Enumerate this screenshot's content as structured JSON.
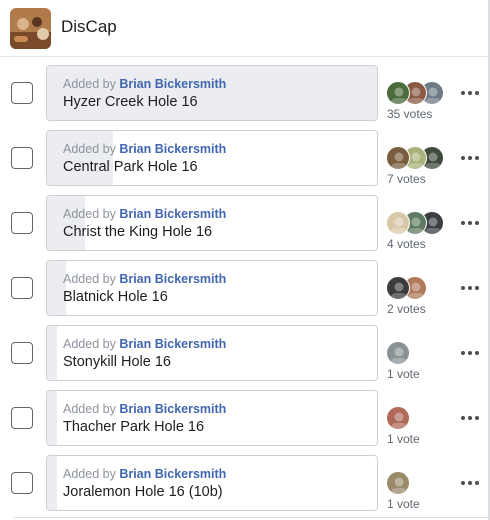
{
  "group": {
    "name": "DisCap",
    "thumbnail_icon": "group-photo"
  },
  "colors": {
    "author_link": "#4267b2",
    "vote_fill": "#ebedf0",
    "muted_text": "#8d949e"
  },
  "poll": {
    "added_prefix": "Added by",
    "options": [
      {
        "title": "Hyzer Creek Hole 16",
        "author": "Brian Bickersmith",
        "votes_label": "35 votes",
        "vote_share": 1.0,
        "voter_avatars": 3
      },
      {
        "title": "Central Park Hole 16",
        "author": "Brian Bickersmith",
        "votes_label": "7 votes",
        "vote_share": 0.2,
        "voter_avatars": 3
      },
      {
        "title": "Christ the King Hole 16",
        "author": "Brian Bickersmith",
        "votes_label": "4 votes",
        "vote_share": 0.114,
        "voter_avatars": 3
      },
      {
        "title": "Blatnick Hole 16",
        "author": "Brian Bickersmith",
        "votes_label": "2 votes",
        "vote_share": 0.057,
        "voter_avatars": 2
      },
      {
        "title": "Stonykill Hole 16",
        "author": "Brian Bickersmith",
        "votes_label": "1 vote",
        "vote_share": 0.029,
        "voter_avatars": 1
      },
      {
        "title": "Thacher Park Hole 16",
        "author": "Brian Bickersmith",
        "votes_label": "1 vote",
        "vote_share": 0.029,
        "voter_avatars": 1
      },
      {
        "title": "Joralemon Hole 16 (10b)",
        "author": "Brian Bickersmith",
        "votes_label": "1 vote",
        "vote_share": 0.029,
        "voter_avatars": 1
      }
    ]
  }
}
